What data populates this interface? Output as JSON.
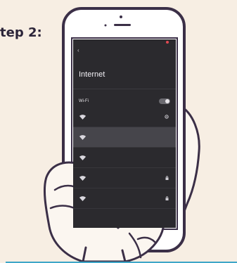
{
  "step_label": "tep 2:",
  "status_bar": {
    "left": "",
    "right": ""
  },
  "screen": {
    "back_label": "‹",
    "title": "Internet",
    "helper_text": "",
    "wifi": {
      "label": "Wi-Fi",
      "sublabel": "",
      "enabled": true
    },
    "networks": [
      {
        "name": "",
        "detail": "",
        "active": false,
        "icon": "wifi-icon",
        "trailing": "settings-icon"
      },
      {
        "name": "",
        "detail": "",
        "active": true,
        "icon": "wifi-icon",
        "trailing": ""
      },
      {
        "name": "",
        "detail": "",
        "active": false,
        "icon": "wifi-icon",
        "trailing": ""
      },
      {
        "name": "",
        "detail": "",
        "active": false,
        "icon": "wifi-icon",
        "trailing": "lock-icon"
      },
      {
        "name": "",
        "detail": "",
        "active": false,
        "icon": "wifi-icon",
        "trailing": "lock-icon"
      }
    ]
  },
  "colors": {
    "background": "#f7eee3",
    "outline": "#3b2f47",
    "rule": "#3fa7c8",
    "screen": "#2b2a2e"
  }
}
